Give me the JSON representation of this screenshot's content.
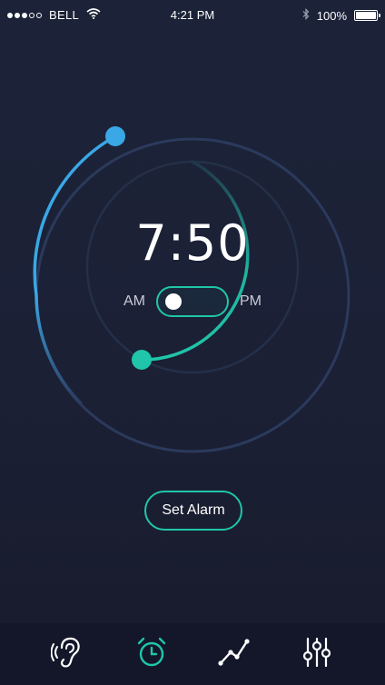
{
  "status_bar": {
    "carrier": "BELL",
    "time": "4:21 PM",
    "battery": "100%",
    "battery_level": 1.0,
    "signal_bars": 3,
    "signal_total": 5
  },
  "alarm": {
    "time": "7:50",
    "am_label": "AM",
    "pm_label": "PM",
    "period_selected": "AM",
    "set_button": "Set Alarm"
  },
  "tabs": [
    {
      "icon": "ear-icon",
      "active": false
    },
    {
      "icon": "alarm-clock-icon",
      "active": true
    },
    {
      "icon": "trend-chart-icon",
      "active": false
    },
    {
      "icon": "equalizer-icon",
      "active": false
    }
  ],
  "colors": {
    "accent_teal": "#1fc6a9",
    "accent_blue": "#3aa7e6",
    "ring_dim": "#2b3a5c"
  }
}
